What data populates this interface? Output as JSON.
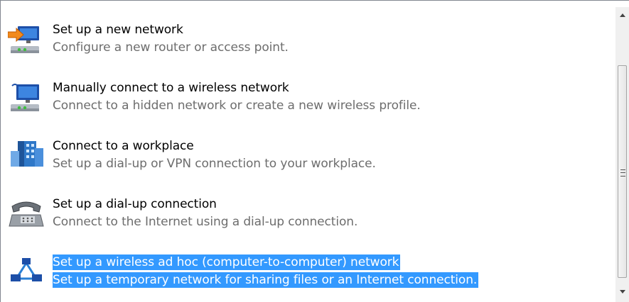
{
  "options": [
    {
      "title": "Set up a new network",
      "description": "Configure a new router or access point.",
      "icon": "router-icon"
    },
    {
      "title": "Manually connect to a wireless network",
      "description": "Connect to a hidden network or create a new wireless profile.",
      "icon": "wireless-icon"
    },
    {
      "title": "Connect to a workplace",
      "description": "Set up a dial-up or VPN connection to your workplace.",
      "icon": "workplace-icon"
    },
    {
      "title": "Set up a dial-up connection",
      "description": "Connect to the Internet using a dial-up connection.",
      "icon": "phone-icon"
    },
    {
      "title": "Set up a wireless ad hoc (computer-to-computer) network",
      "description": "Set up a temporary network for sharing files or an Internet connection.",
      "icon": "adhoc-network-icon",
      "selected": true
    }
  ],
  "colors": {
    "selection": "#3399ff",
    "description_text": "#6d6d6d"
  }
}
